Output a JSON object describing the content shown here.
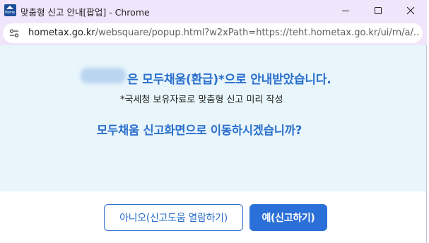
{
  "window": {
    "title": "맞춤형 신고 안내[팝업] - Chrome",
    "app_icon_text": "Home"
  },
  "address_bar": {
    "domain": "hometax.go.kr",
    "path": "/websquare/popup.html?w2xPath=https://teht.hometax.go.kr/ui/rn/a/..."
  },
  "notice": {
    "headline": "은 모두채움(환급)*으로 안내받았습니다.",
    "subline": "*국세청 보유자료로 맞춤형 신고 미리 작성",
    "question": "모두채움 신고화면으로 이동하시겠습니까?"
  },
  "buttons": {
    "no_label": "아니오(신고도움 열람하기)",
    "yes_label": "예(신고하기)"
  },
  "colors": {
    "accent": "#2a6fcc",
    "content_bg": "#e8f5fb",
    "titlebar_bg": "#f0e5fb"
  }
}
